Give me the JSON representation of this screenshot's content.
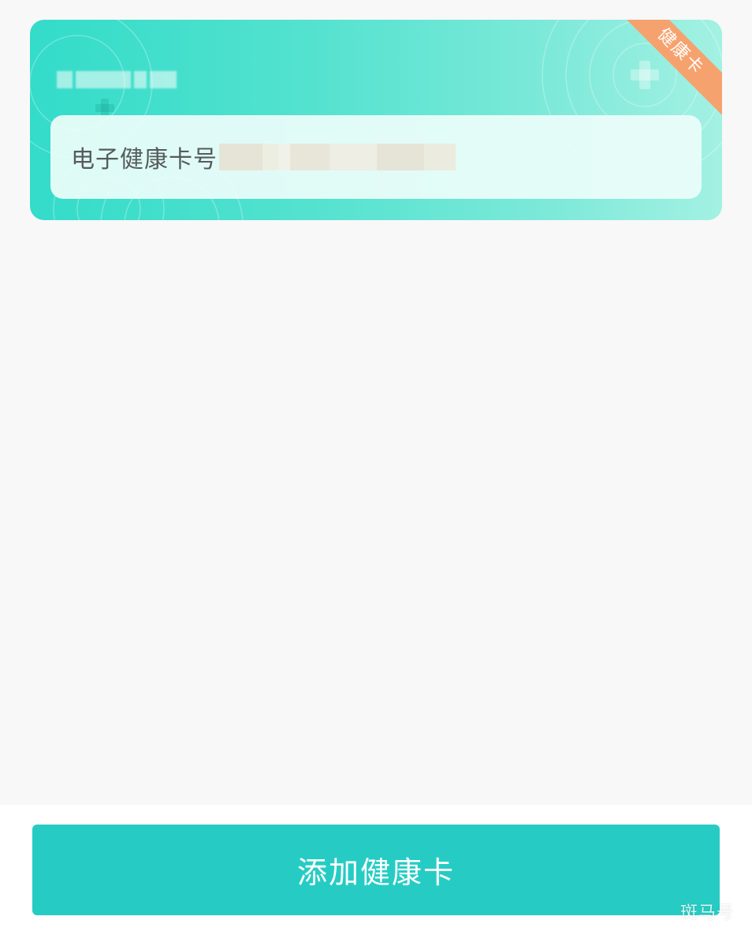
{
  "card": {
    "ribbon_text": "健康卡",
    "number_label": "电子健康卡号"
  },
  "actions": {
    "add_card_label": "添加健康卡"
  },
  "watermark": "斑马号",
  "colors": {
    "card_start": "#33dcc9",
    "card_end": "#a3f1e3",
    "ribbon": "#f6a26e",
    "button": "#26ccc4",
    "page_bg": "#f8f8f8"
  }
}
